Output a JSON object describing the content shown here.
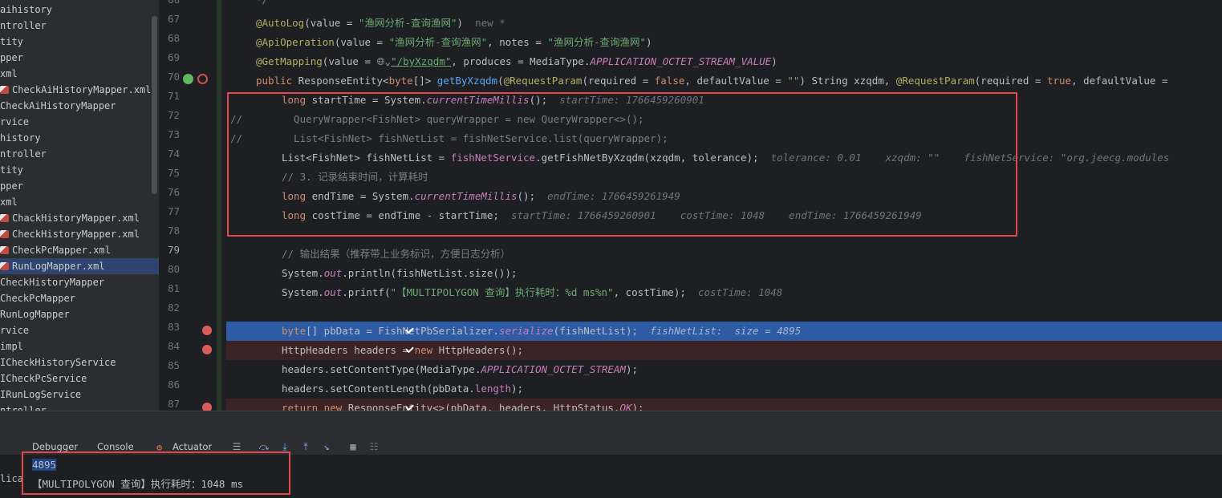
{
  "project_tree": [
    {
      "label": "aihistory",
      "icon": "none"
    },
    {
      "label": "ntroller",
      "icon": "none"
    },
    {
      "label": "tity",
      "icon": "none"
    },
    {
      "label": "pper",
      "icon": "none"
    },
    {
      "label": "xml",
      "icon": "none"
    },
    {
      "label": "CheckAiHistoryMapper.xml",
      "icon": "xml-icon"
    },
    {
      "label": "CheckAiHistoryMapper",
      "icon": "none"
    },
    {
      "label": "rvice",
      "icon": "none"
    },
    {
      "label": "history",
      "icon": "none"
    },
    {
      "label": "ntroller",
      "icon": "none"
    },
    {
      "label": "tity",
      "icon": "none"
    },
    {
      "label": "pper",
      "icon": "none"
    },
    {
      "label": "xml",
      "icon": "none"
    },
    {
      "label": "ChackHistoryMapper.xml",
      "icon": "xml-icon"
    },
    {
      "label": "CheckHistoryMapper.xml",
      "icon": "xml-icon"
    },
    {
      "label": "CheckPcMapper.xml",
      "icon": "xml-icon"
    },
    {
      "label": "RunLogMapper.xml",
      "icon": "xml-icon",
      "selected": true
    },
    {
      "label": "CheckHistoryMapper",
      "icon": "none"
    },
    {
      "label": "CheckPcMapper",
      "icon": "none"
    },
    {
      "label": "RunLogMapper",
      "icon": "none"
    },
    {
      "label": "rvice",
      "icon": "none"
    },
    {
      "label": "impl",
      "icon": "none"
    },
    {
      "label": "ICheckHistoryService",
      "icon": "none"
    },
    {
      "label": "ICheckPcService",
      "icon": "none"
    },
    {
      "label": "IRunLogService",
      "icon": "none"
    },
    {
      "label": "ntroller",
      "icon": "none"
    }
  ],
  "line_numbers": [
    "66",
    "67",
    "68",
    "69",
    "70",
    "71",
    "72",
    "73",
    "74",
    "75",
    "76",
    "77",
    "78",
    "79",
    "80",
    "81",
    "82",
    "83",
    "84",
    "85",
    "86",
    "87"
  ],
  "code": {
    "l66": "*/",
    "l67_ann": "@AutoLog",
    "l67_a": "(value = ",
    "l67_str": "\"渔网分析-查询渔网\"",
    "l67_b": ")",
    "l67_hint": "new *",
    "l68_ann": "@ApiOperation",
    "l68_a": "(value = ",
    "l68_str1": "\"渔网分析-查询渔网\"",
    "l68_b": ", notes = ",
    "l68_str2": "\"渔网分析-查询渔网\"",
    "l68_c": ")",
    "l69_ann": "@GetMapping",
    "l69_a": "(value = ",
    "l69_globe": "🌐︎⌄",
    "l69_str": "\"/byXzqdm\"",
    "l69_b": ", produces = MediaType.",
    "l69_const": "APPLICATION_OCTET_STREAM_VALUE",
    "l69_c": ")",
    "l70_kw": "public",
    "l70_a": " ResponseEntity<",
    "l70_kw2": "byte",
    "l70_b": "[]> ",
    "l70_fn": "getByXzqdm",
    "l70_c": "(",
    "l70_ann": "@RequestParam",
    "l70_d": "(required = ",
    "l70_kw3": "false",
    "l70_e": ", defaultValue = ",
    "l70_str": "\"\"",
    "l70_f": ") String xzqdm, ",
    "l70_ann2": "@RequestParam",
    "l70_g": "(required = ",
    "l70_kw4": "true",
    "l70_h": ", defaultValue =",
    "l71_kw": "long",
    "l71_a": " startTime = System.",
    "l71_static": "currentTimeMillis",
    "l71_b": "();",
    "l71_hint": "startTime: 1766459260901",
    "l72_prefix": "//",
    "l72": "  QueryWrapper<FishNet> queryWrapper = new QueryWrapper<>();",
    "l73_prefix": "//",
    "l73": "  List<FishNet> fishNetList = fishNetService.list(queryWrapper);",
    "l74_a": "List<FishNet> fishNetList = ",
    "l74_purple": "fishNetService",
    "l74_b": ".getFishNetByXzqdm(xzqdm, tolerance);",
    "l74_hint": "tolerance: 0.01    xzqdm: \"\"    fishNetService: \"org.jeecg.modules",
    "l75": "// 3. 记录结束时间，计算耗时",
    "l76_kw": "long",
    "l76_a": " endTime = System.",
    "l76_static": "currentTimeMillis",
    "l76_b": "();",
    "l76_hint": "endTime: 1766459261949",
    "l77_kw": "long",
    "l77_a": " costTime = endTime - startTime;",
    "l77_hint": "startTime: 1766459260901    costTime: 1048    endTime: 1766459261949",
    "l79": "// 输出结果（推荐带上业务标识，方便日志分析）",
    "l80_a": "System.",
    "l80_static": "out",
    "l80_b": ".println(fishNetList.size());",
    "l81_a": "System.",
    "l81_static": "out",
    "l81_b": ".printf(",
    "l81_str": "\"【MULTIPOLYGON 查询】执行耗时：%d ms%n\"",
    "l81_c": ", costTime);",
    "l81_hint": "costTime: 1048",
    "l83_kw": "byte",
    "l83_a": "[] pbData = FishNetPbSerializer.",
    "l83_static": "serialize",
    "l83_b": "(fishNetList);",
    "l83_hint": "fishNetList:  size = 4895",
    "l84_a": "HttpHeaders headers = ",
    "l84_kw": "new",
    "l84_b": " HttpHeaders();",
    "l85_a": "headers.setContentType(MediaType.",
    "l85_const": "APPLICATION_OCTET_STREAM",
    "l85_b": ");",
    "l86_a": "headers.setContentLength(pbData.",
    "l86_purple": "length",
    "l86_b": ");",
    "l87_kw": "return new",
    "l87_a": " ResponseEntity<>(pbData, headers, HttpStatus.",
    "l87_const": "OK",
    "l87_b": ");"
  },
  "toolbar": {
    "tab_debugger": "Debugger",
    "tab_console": "Console",
    "tab_actuator": "Actuator",
    "icons": [
      "menu-icon",
      "step-over-icon",
      "step-into-icon",
      "step-out-icon",
      "run-to-cursor-icon",
      "table-icon",
      "evaluate-icon"
    ]
  },
  "console": {
    "line1": "4895",
    "line2": "【MULTIPOLYGON 查询】执行耗时：1048 ms",
    "left_label": "lica"
  },
  "colors": {
    "exec_line": "#2d5ca5",
    "breakpoint": "#db5c5c",
    "highlight_box": "#e0494d"
  }
}
